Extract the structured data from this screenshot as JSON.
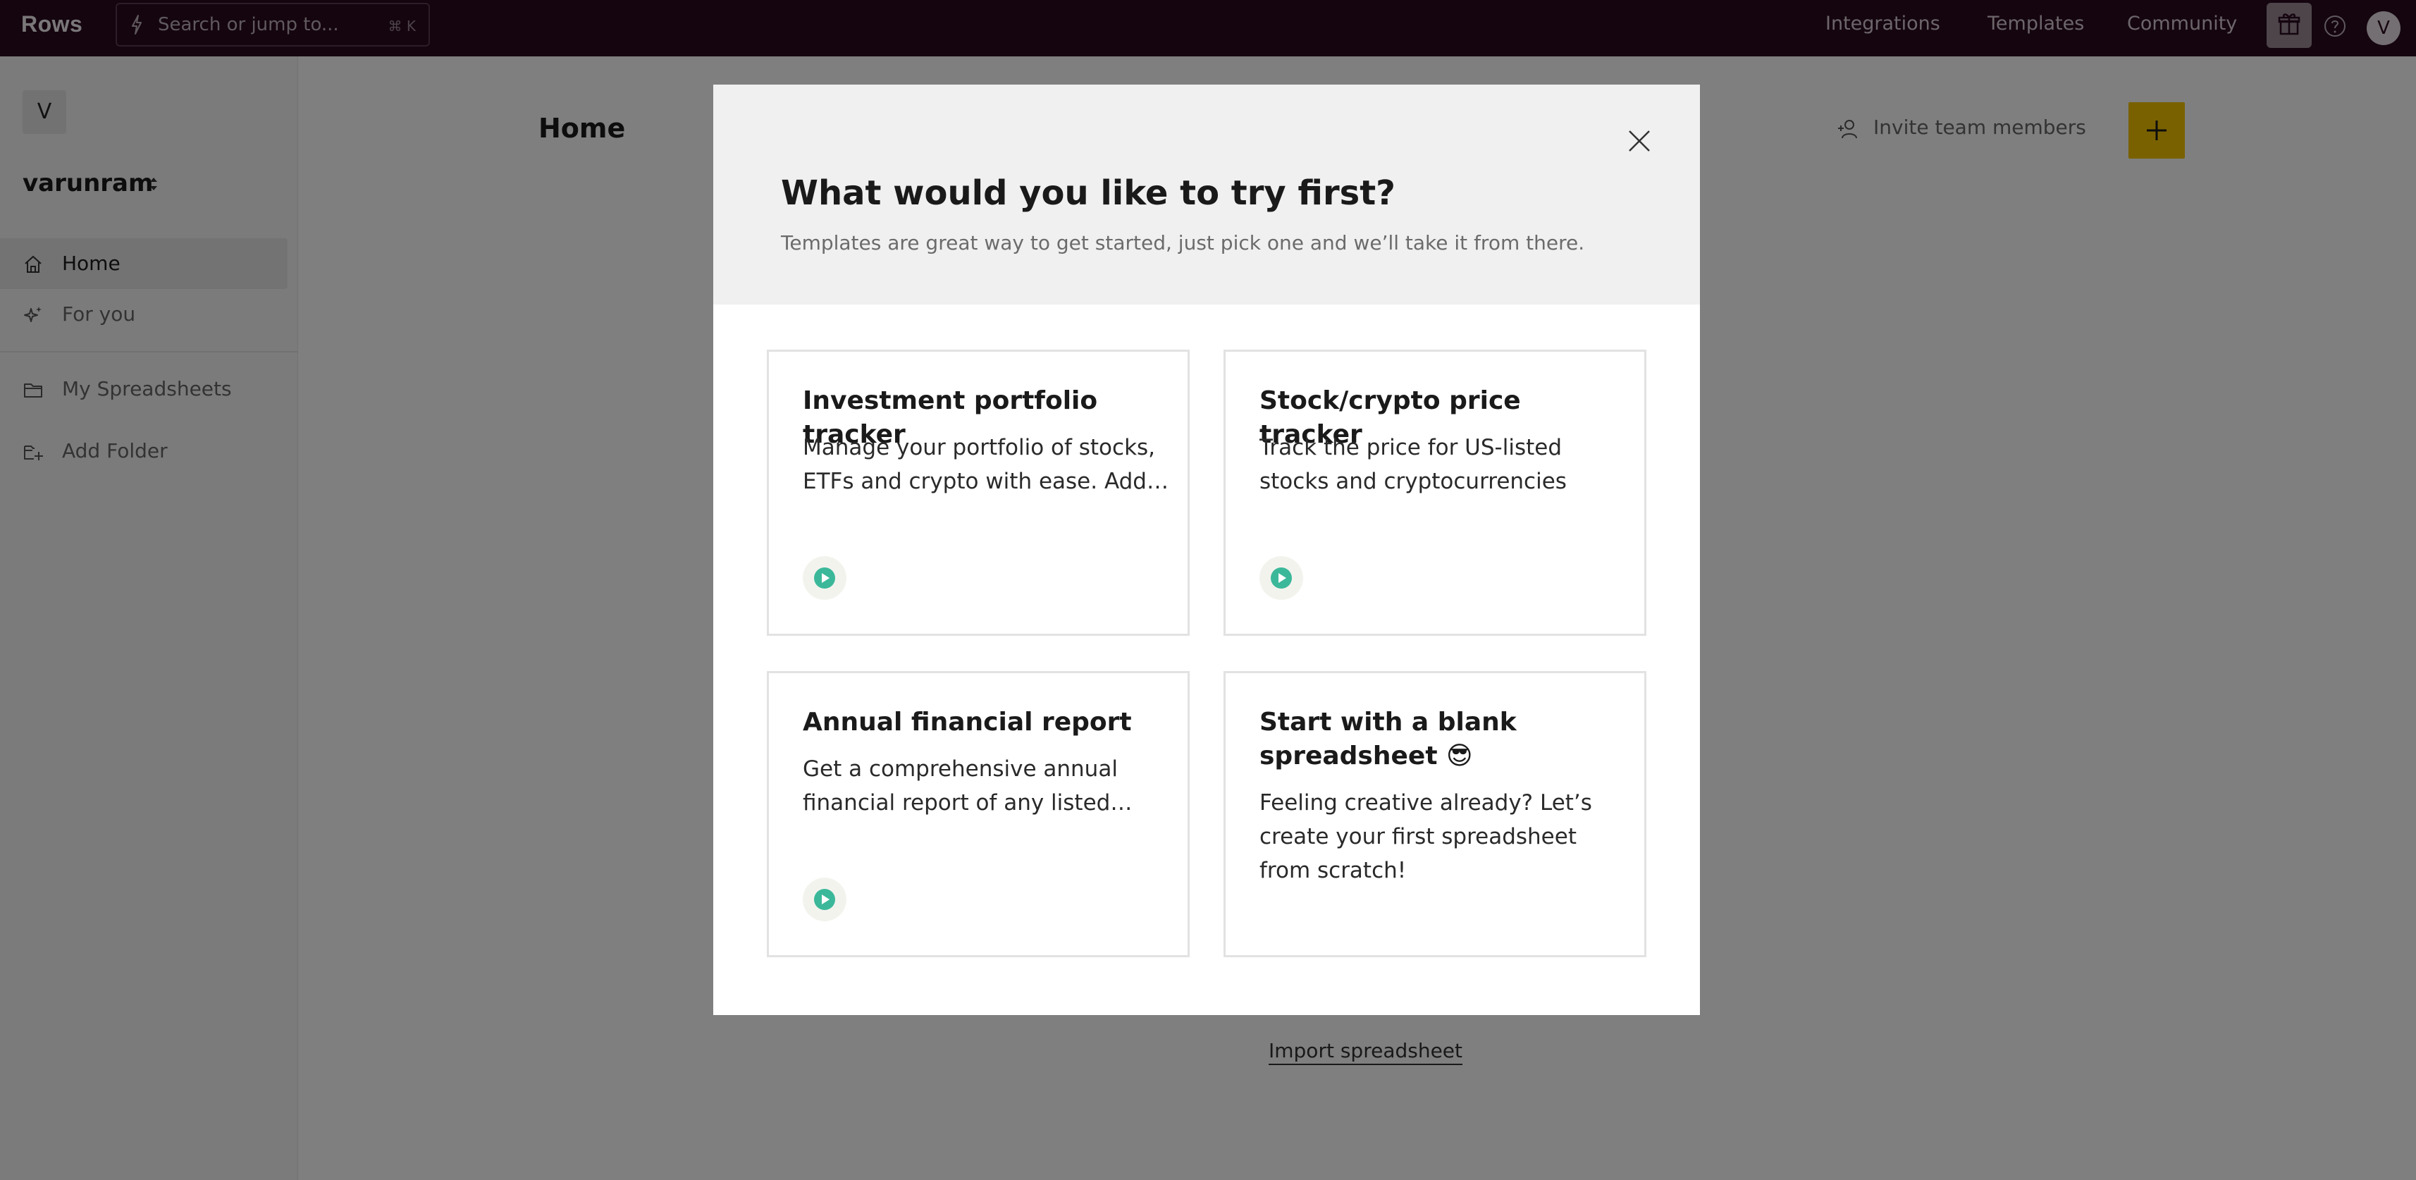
{
  "topbar": {
    "logo": "Rows",
    "search_placeholder": "Search or jump to...",
    "search_shortcut": "⌘ K",
    "nav": [
      "Integrations",
      "Templates",
      "Community"
    ],
    "avatar_initial": "V",
    "background_color": "#2a0a1f"
  },
  "sidebar": {
    "workspace_initial": "V",
    "workspace_name": "varunram",
    "items": [
      {
        "label": "Home",
        "icon": "home-icon",
        "active": true
      },
      {
        "label": "For you",
        "icon": "sparkle-icon",
        "active": false
      },
      {
        "label": "My Spreadsheets",
        "icon": "folder-icon",
        "active": false
      },
      {
        "label": "Add Folder",
        "icon": "folder-plus-icon",
        "active": false
      }
    ]
  },
  "main": {
    "title": "Home",
    "invite_label": "Invite team members",
    "import_label": "Import spreadsheet",
    "accent_color": "#f2c200"
  },
  "modal": {
    "title": "What would you like to try first?",
    "subtitle": "Templates are great way to get started, just pick one and we’ll take it from there.",
    "cards": [
      {
        "title": "Investment portfolio tracker",
        "description": "Manage your portfolio of stocks, ETFs and crypto with ease. Add your holdings and track performance.",
        "has_play": true
      },
      {
        "title": "Stock/crypto price tracker",
        "description": "Track the price for US-listed stocks and cryptocurrencies",
        "has_play": true
      },
      {
        "title": "Annual financial report",
        "description": "Get a comprehensive annual financial report of any listed company.",
        "has_play": true
      },
      {
        "title": "Start with a blank spreadsheet 😎",
        "description": "Feeling creative already? Let’s create your first spreadsheet from scratch!",
        "has_play": false
      }
    ],
    "play_color": "#3bb89a"
  }
}
